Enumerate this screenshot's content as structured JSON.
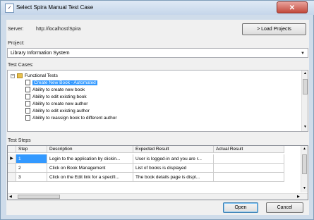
{
  "window": {
    "title": "Select Spira Manual Test Case",
    "close_glyph": "✕"
  },
  "server": {
    "label": "Server:",
    "value": "http://localhost/Spira"
  },
  "load_projects_button": "> Load Projects",
  "project": {
    "label": "Project:",
    "selected": "Library Information System"
  },
  "test_cases": {
    "label": "Test Cases:",
    "root": "Functional Tests",
    "items": [
      "Create New Book - Automated",
      "Ability to create new book",
      "Ability to edit existing book",
      "Ability to create new author",
      "Ability to edit existing author",
      "Ability to reassign book to different author"
    ],
    "selected_index": 0
  },
  "test_steps": {
    "label": "Test Steps",
    "columns": [
      "Step",
      "Description",
      "Expected Result",
      "Actual Result"
    ],
    "rows": [
      {
        "step": "1",
        "description": "Login to the application by clickin...",
        "expected": "User is logged-in and you are r...",
        "actual": ""
      },
      {
        "step": "2",
        "description": "Click on Book Management",
        "expected": "List of books is displayed",
        "actual": ""
      },
      {
        "step": "3",
        "description": "Click on the Edit link for a specifi...",
        "expected": "The book details page is displ...",
        "actual": ""
      }
    ],
    "current_row_marker": "▶"
  },
  "buttons": {
    "open": "Open",
    "cancel": "Cancel"
  },
  "colors": {
    "selection": "#3399ff",
    "close_button": "#c24a3d"
  }
}
